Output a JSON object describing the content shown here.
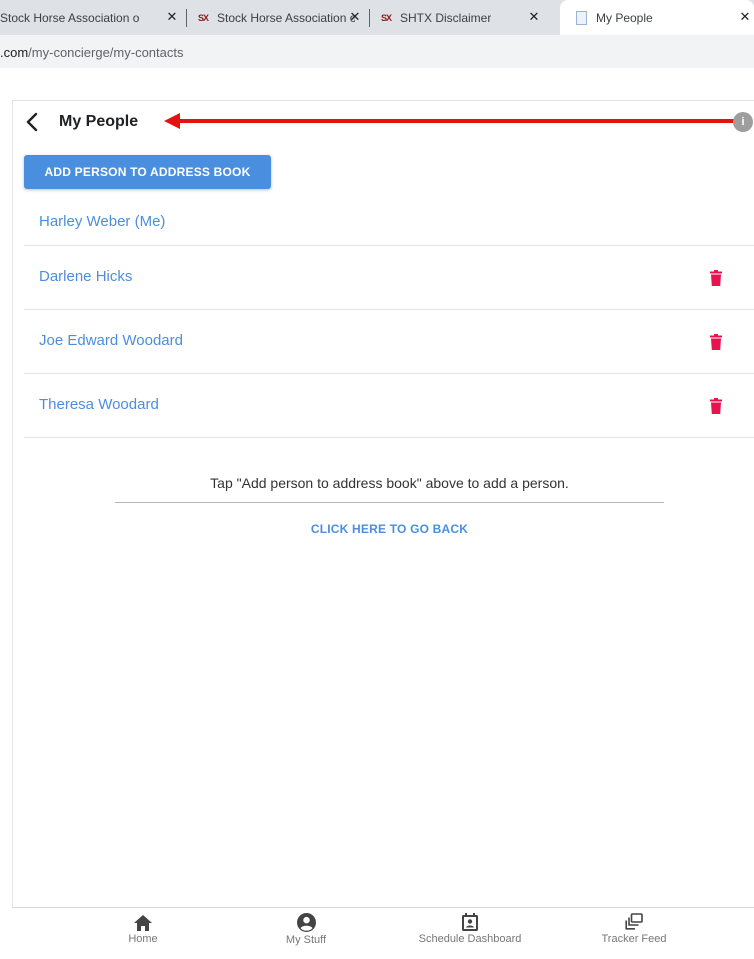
{
  "browser": {
    "tabs": [
      {
        "title": "Stock Horse Association o",
        "favicon": "shtx-logo",
        "active": false
      },
      {
        "title": "Stock Horse Association o",
        "favicon": "shtx-logo",
        "active": false
      },
      {
        "title": "SHTX Disclaimer",
        "favicon": "shtx-logo",
        "active": false
      },
      {
        "title": "My People",
        "favicon": "document-icon",
        "active": true
      }
    ],
    "favicon_text": "SX",
    "close_glyph": "✕",
    "url_host": ".com",
    "url_path": "/my-concierge/my-contacts"
  },
  "header": {
    "title": "My People",
    "info_glyph": "i"
  },
  "add_button_label": "ADD PERSON TO ADDRESS BOOK",
  "contacts": [
    {
      "name": "Harley Weber (Me)",
      "deletable": false
    },
    {
      "name": "Darlene Hicks",
      "deletable": true
    },
    {
      "name": "Joe Edward Woodard",
      "deletable": true
    },
    {
      "name": "Theresa Woodard",
      "deletable": true
    }
  ],
  "hint": "Tap \"Add person to address book\" above to add a person.",
  "go_back_label": "CLICK HERE TO GO BACK",
  "bottom_nav": [
    {
      "label": "Home",
      "icon": "home-icon"
    },
    {
      "label": "My Stuff",
      "icon": "account-circle-icon"
    },
    {
      "label": "Schedule Dashboard",
      "icon": "contact-calendar-icon"
    },
    {
      "label": "Tracker Feed",
      "icon": "feed-icon"
    }
  ],
  "colors": {
    "accent": "#4a8fdf",
    "delete": "#e8124f",
    "annotation_arrow": "#e3130f"
  }
}
